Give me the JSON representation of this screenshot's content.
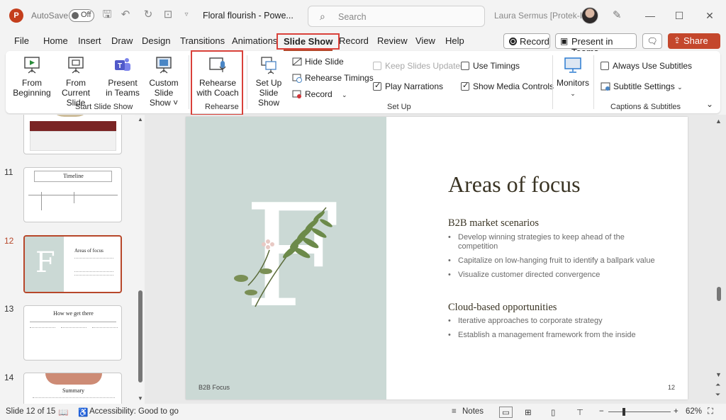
{
  "titlebar": {
    "autosave_label": "AutoSave",
    "autosave_state": "Off",
    "doc_title": "Floral flourish  -  Powe...",
    "search_placeholder": "Search",
    "user_name": "Laura Sermus [Protek-IT]"
  },
  "menu": {
    "tabs": [
      "File",
      "Home",
      "Insert",
      "Draw",
      "Design",
      "Transitions",
      "Animations",
      "Slide Show",
      "Record",
      "Review",
      "View",
      "Help"
    ],
    "active_tab": "Slide Show",
    "record_label": "Record",
    "present_teams_label": "Present in Teams",
    "share_label": "Share"
  },
  "ribbon": {
    "from_beginning": [
      "From",
      "Beginning"
    ],
    "from_current": [
      "From",
      "Current Slide"
    ],
    "present_teams": [
      "Present",
      "in Teams"
    ],
    "custom_show": [
      "Custom Slide",
      "Show ˅"
    ],
    "group_start": "Start Slide Show",
    "rehearse_coach": [
      "Rehearse",
      "with Coach"
    ],
    "group_rehearse": "Rehearse",
    "setup_show": [
      "Set Up",
      "Slide Show"
    ],
    "hide_slide": "Hide Slide",
    "rehearse_timings": "Rehearse Timings",
    "record_menu": "Record",
    "keep_updated": "Keep Slides Updated",
    "use_timings": "Use Timings",
    "play_narrations": "Play Narrations",
    "show_media": "Show Media Controls",
    "group_setup": "Set Up",
    "monitors": "Monitors",
    "always_subtitles": "Always Use Subtitles",
    "subtitle_settings": "Subtitle Settings",
    "group_captions": "Captions & Subtitles"
  },
  "thumbs": [
    {
      "num": "",
      "title": ""
    },
    {
      "num": "11",
      "title": "Timeline"
    },
    {
      "num": "12",
      "title": "Areas of focus"
    },
    {
      "num": "13",
      "title": "How we get there"
    },
    {
      "num": "14",
      "title": "Summary"
    }
  ],
  "slide": {
    "title": "Areas of focus",
    "section1": "B2B market scenarios",
    "bullets1": [
      "Develop winning strategies to keep ahead of the competition",
      "Capitalize on low-hanging fruit to identify a ballpark value",
      "Visualize customer directed convergence"
    ],
    "section2": "Cloud-based opportunities",
    "bullets2": [
      "Iterative approaches to corporate strategy",
      "Establish a management framework from the inside"
    ],
    "big_letter": "F",
    "footer": "B2B Focus",
    "page": "12"
  },
  "status": {
    "slide_info": "Slide 12 of 15",
    "accessibility": "Accessibility: Good to go",
    "notes": "Notes",
    "zoom": "62%"
  }
}
